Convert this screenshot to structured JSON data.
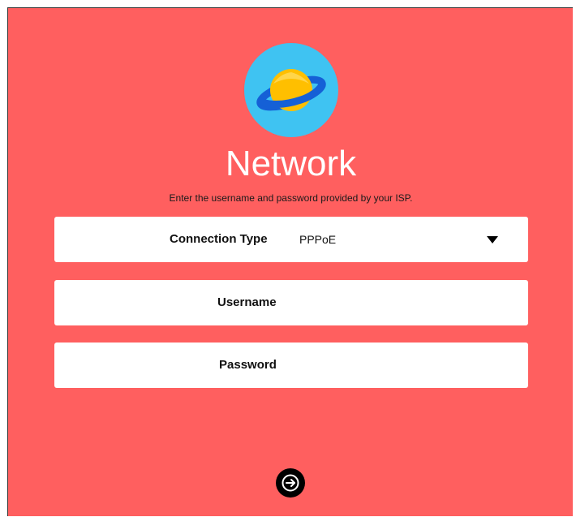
{
  "header": {
    "logo_icon": "planet-icon",
    "title": "Network",
    "subtitle": "Enter the username and password provided by your ISP."
  },
  "form": {
    "connection_type": {
      "label": "Connection Type",
      "value": "PPPoE",
      "icon": "caret-down-icon"
    },
    "username": {
      "label": "Username"
    },
    "password": {
      "label": "Password"
    }
  },
  "actions": {
    "next_icon": "arrow-right-icon"
  },
  "colors": {
    "background": "#ff5f5f",
    "logo_circle": "#3fc3f2",
    "planet": "#ffbf00",
    "ring": "#1560d6"
  }
}
